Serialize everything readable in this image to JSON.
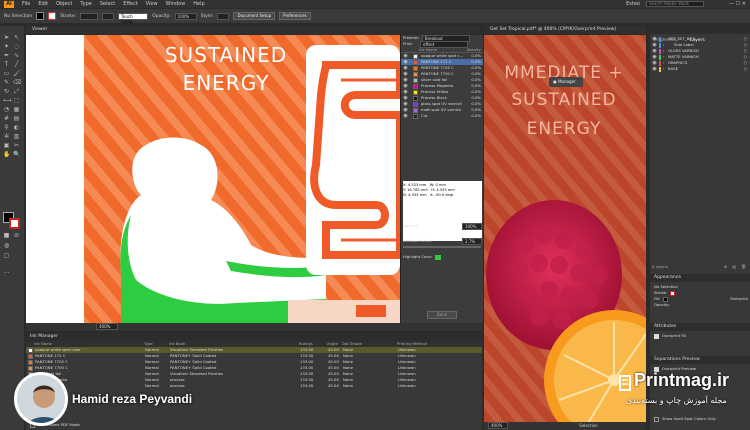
{
  "menubar": {
    "app_logo": "Ai",
    "items": [
      "File",
      "Edit",
      "Object",
      "Type",
      "Select",
      "Effect",
      "View",
      "Window",
      "Help"
    ],
    "workspace": "Esteo",
    "search_placeholder": "Search Adobe Stock"
  },
  "control_bar": {
    "selection": "No Selection",
    "stroke_label": "Stroke:",
    "brush": "Touch Callig...",
    "opacity_label": "Opacity:",
    "opacity_value": "100%",
    "style_label": "Style:",
    "doc_setup": "Document Setup",
    "preferences": "Preferences"
  },
  "docs": {
    "left_tab": "Viewer",
    "right_tab": "Get Set Tropical.pdf* @ 400% (CMYK/Overprint Preview)"
  },
  "artwork": {
    "left_title_1": "SUSTAINED",
    "left_title_2": "ENERGY",
    "right_title_1": "MMEDIATE +",
    "right_title_2": "SUSTAINED",
    "right_title_3": "ENERGY",
    "tooltip": "Manager"
  },
  "separations": {
    "preview_label": "Preview:",
    "preview_value": "Breakout",
    "print_label": "Print:",
    "print_value": "offset",
    "col_ink": "Ink Name",
    "col_density": "Density",
    "inks": [
      {
        "name": "opaque white spot c...",
        "density": "0.0%",
        "color": "#ffffff"
      },
      {
        "name": "PANTONE 172 C",
        "density": "0.0%",
        "color": "#f05a28"
      },
      {
        "name": "PANTONE 7705 C",
        "density": "0.0%",
        "color": "#e8742a"
      },
      {
        "name": "PANTONE 7700 C",
        "density": "0.0%",
        "color": "#f08a3c"
      },
      {
        "name": "silver cold foil",
        "density": "0.0%",
        "color": "#b8b8b8"
      },
      {
        "name": "Process Magenta",
        "density": "0.0%",
        "color": "#e6007e"
      },
      {
        "name": "Process Yellow",
        "density": "0.0%",
        "color": "#ffed00"
      },
      {
        "name": "Process Black",
        "density": "0.0%",
        "color": "#1a1a1a"
      },
      {
        "name": "gloss spot UV varnish",
        "density": "0.0%",
        "color": "#8a2be2"
      },
      {
        "name": "matt spot UV varnish",
        "density": "0.0%",
        "color": "#9370db"
      },
      {
        "name": "Cut",
        "density": "0.0%",
        "color": "#222222"
      }
    ],
    "x_label": "X:",
    "x_value": "4.333 mm",
    "y_label": "Y:",
    "y_value": "16.785 mm",
    "w_label": "W:",
    "w_value": "0 mm",
    "h_label": "H:",
    "h_value": "4.333 mm",
    "d_label": "D:",
    "d_value": "4.333 mm",
    "a_label": "A:",
    "a_value": "-90.0 degr.",
    "density_label": "Density:",
    "density_value": "100%",
    "breakout_label": "Breakout Limit:",
    "breakout_value": "2.7%",
    "highlight_label": "Highlight Color:",
    "done_button": "Done"
  },
  "zoom": {
    "left": "400%",
    "right": "400%",
    "status_right": "Selection"
  },
  "ink_manager": {
    "title": "Ink Manager",
    "columns": [
      "Ink Name",
      "Type",
      "Ink Book",
      "Rulings",
      "Angle",
      "Dot Shape",
      "Printing Method"
    ],
    "rows": [
      {
        "name": "opaque white spot color",
        "type": "Normal",
        "book": "Visualizer Standard Finishes",
        "ruling": "133.00",
        "angle": "45.00",
        "dot": "None",
        "method": "Unknown",
        "color": "#ffffff"
      },
      {
        "name": "PANTONE 172 C",
        "type": "Normal",
        "book": "PANTONE+ Solid Coated",
        "ruling": "133.00",
        "angle": "45.00",
        "dot": "None",
        "method": "Unknown",
        "color": "#f05a28"
      },
      {
        "name": "PANTONE 7705 C",
        "type": "Normal",
        "book": "PANTONE+ Solid Coated",
        "ruling": "133.00",
        "angle": "45.00",
        "dot": "None",
        "method": "Unknown",
        "color": "#e8742a"
      },
      {
        "name": "PANTONE 7700 C",
        "type": "Normal",
        "book": "PANTONE+ Solid Coated",
        "ruling": "133.00",
        "angle": "45.00",
        "dot": "None",
        "method": "Unknown",
        "color": "#f08a3c"
      },
      {
        "name": "silver cold foil",
        "type": "Normal",
        "book": "Visualizer Standard Finishes",
        "ruling": "133.00",
        "angle": "45.00",
        "dot": "None",
        "method": "Unknown",
        "color": "#b8b8b8"
      },
      {
        "name": "Process Magenta",
        "type": "Normal",
        "book": "process",
        "ruling": "133.00",
        "angle": "45.00",
        "dot": "None",
        "method": "Unknown",
        "color": "#e6007e"
      },
      {
        "name": "Process Black",
        "type": "Normal",
        "book": "process",
        "ruling": "133.00",
        "angle": "45.00",
        "dot": "None",
        "method": "Unknown",
        "color": "#1a1a1a"
      }
    ],
    "footer": "Normalized PDF Mode"
  },
  "right_panels": {
    "tabs": [
      "Properties",
      "Layers"
    ],
    "layers": [
      {
        "name": "GET_SET_BOT...",
        "color": "#4a90e2"
      },
      {
        "name": "Side Label",
        "color": "#4a90e2"
      },
      {
        "name": "GLOSS VARNISH",
        "color": "#d04ad0"
      },
      {
        "name": "MATTE VARNISH",
        "color": "#4ad04a"
      },
      {
        "name": "GRAPHICS",
        "color": "#e04a4a"
      },
      {
        "name": "BASE",
        "color": "#e0c04a"
      }
    ],
    "layers_footer": "6 Layers",
    "appearance_title": "Appearance",
    "appearance_rows": [
      "No Selection",
      "Stroke:",
      "Fill:",
      "Opacity:"
    ],
    "overprint_label": "Overprint",
    "attributes_title": "Attributes",
    "overprint_fill": "Overprint Fill",
    "sep_preview_title": "Separations Preview",
    "overprint_preview": "Overprint Preview",
    "show_used": "Show Used Spot Colors Only"
  },
  "watermark": {
    "presenter": "Hamid reza Peyvandi",
    "brand": "Printmag.ir",
    "tagline": "مجله آموزش چاپ و بسته‌بندی"
  }
}
